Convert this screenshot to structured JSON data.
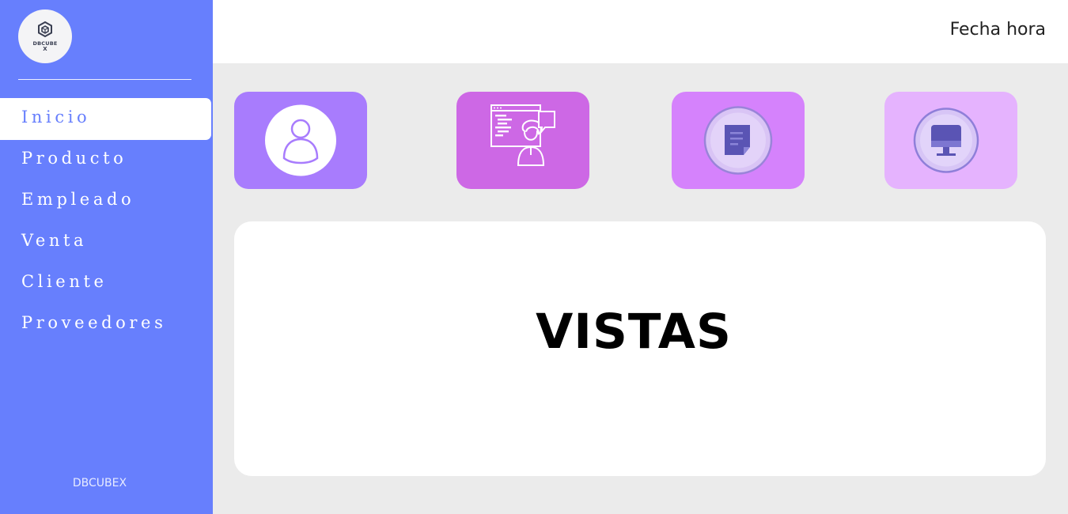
{
  "app": {
    "logo_line1": "DBCUBE",
    "logo_line2": "X",
    "footer": "DBCUBEX"
  },
  "header": {
    "datetime": "Fecha hora"
  },
  "sidebar": {
    "items": [
      {
        "label": "Inicio",
        "active": true
      },
      {
        "label": "Producto",
        "active": false
      },
      {
        "label": "Empleado",
        "active": false
      },
      {
        "label": "Venta",
        "active": false
      },
      {
        "label": "Cliente",
        "active": false
      },
      {
        "label": "Proveedores",
        "active": false
      }
    ]
  },
  "cards": [
    {
      "icon": "user-icon",
      "color": "#a87cfd"
    },
    {
      "icon": "developer-icon",
      "color": "#cd68e5"
    },
    {
      "icon": "document-icon",
      "color": "#d582fc"
    },
    {
      "icon": "monitor-icon",
      "color": "#e5b3fe"
    }
  ],
  "main": {
    "title": "VISTAS"
  },
  "colors": {
    "sidebar": "#677ffd",
    "background": "#ebebeb",
    "panel": "#ffffff"
  }
}
